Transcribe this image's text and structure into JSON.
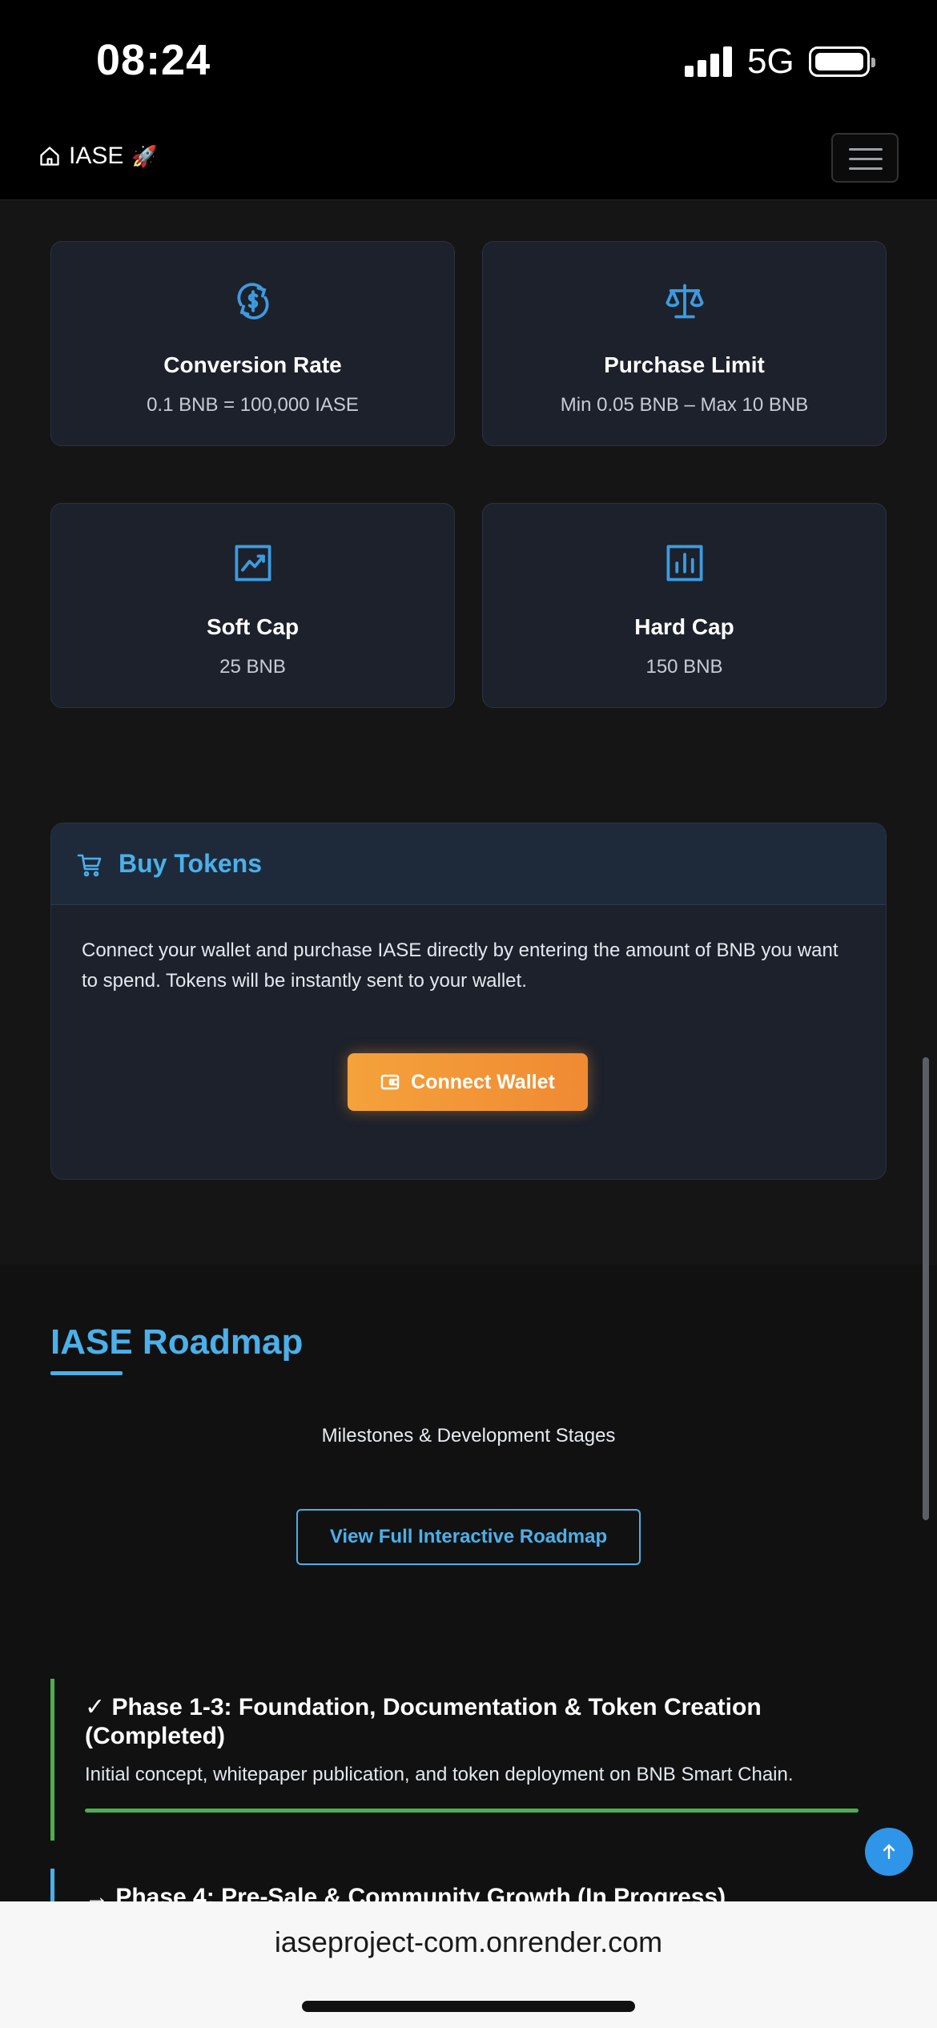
{
  "status_bar": {
    "time": "08:24",
    "network": "5G"
  },
  "navbar": {
    "brand": "IASE",
    "brand_emoji": "🚀",
    "icons": [
      "home-icon",
      "menu-icon"
    ]
  },
  "stats": [
    {
      "icon": "currency-exchange-icon",
      "title": "Conversion Rate",
      "value": "0.1 BNB = 100,000 IASE"
    },
    {
      "icon": "scale-icon",
      "title": "Purchase Limit",
      "value": "Min 0.05 BNB – Max 10 BNB"
    },
    {
      "icon": "trending-chart-icon",
      "title": "Soft Cap",
      "value": "25 BNB"
    },
    {
      "icon": "bar-chart-icon",
      "title": "Hard Cap",
      "value": "150 BNB"
    }
  ],
  "buy": {
    "title": "Buy Tokens",
    "description": "Connect your wallet and purchase IASE directly by entering the amount of BNB you want to spend. Tokens will be instantly sent to your wallet.",
    "button_label": "Connect Wallet"
  },
  "roadmap": {
    "title": "IASE Roadmap",
    "subtitle": "Milestones & Development Stages",
    "button_label": "View Full Interactive Roadmap",
    "phases": [
      {
        "title": "✓ Phase 1-3: Foundation, Documentation & Token Creation (Completed)",
        "description": "Initial concept, whitepaper publication, and token deployment on BNB Smart Chain."
      },
      {
        "title": "→ Phase 4: Pre-Sale & Community Growth (In Progress)"
      }
    ]
  },
  "browser": {
    "url": "iaseproject-com.onrender.com"
  },
  "colors": {
    "accent": "#4ab0ea",
    "button_orange": "#f39a37",
    "completed_green": "#4caf50",
    "card_bg": "#1c212b"
  }
}
